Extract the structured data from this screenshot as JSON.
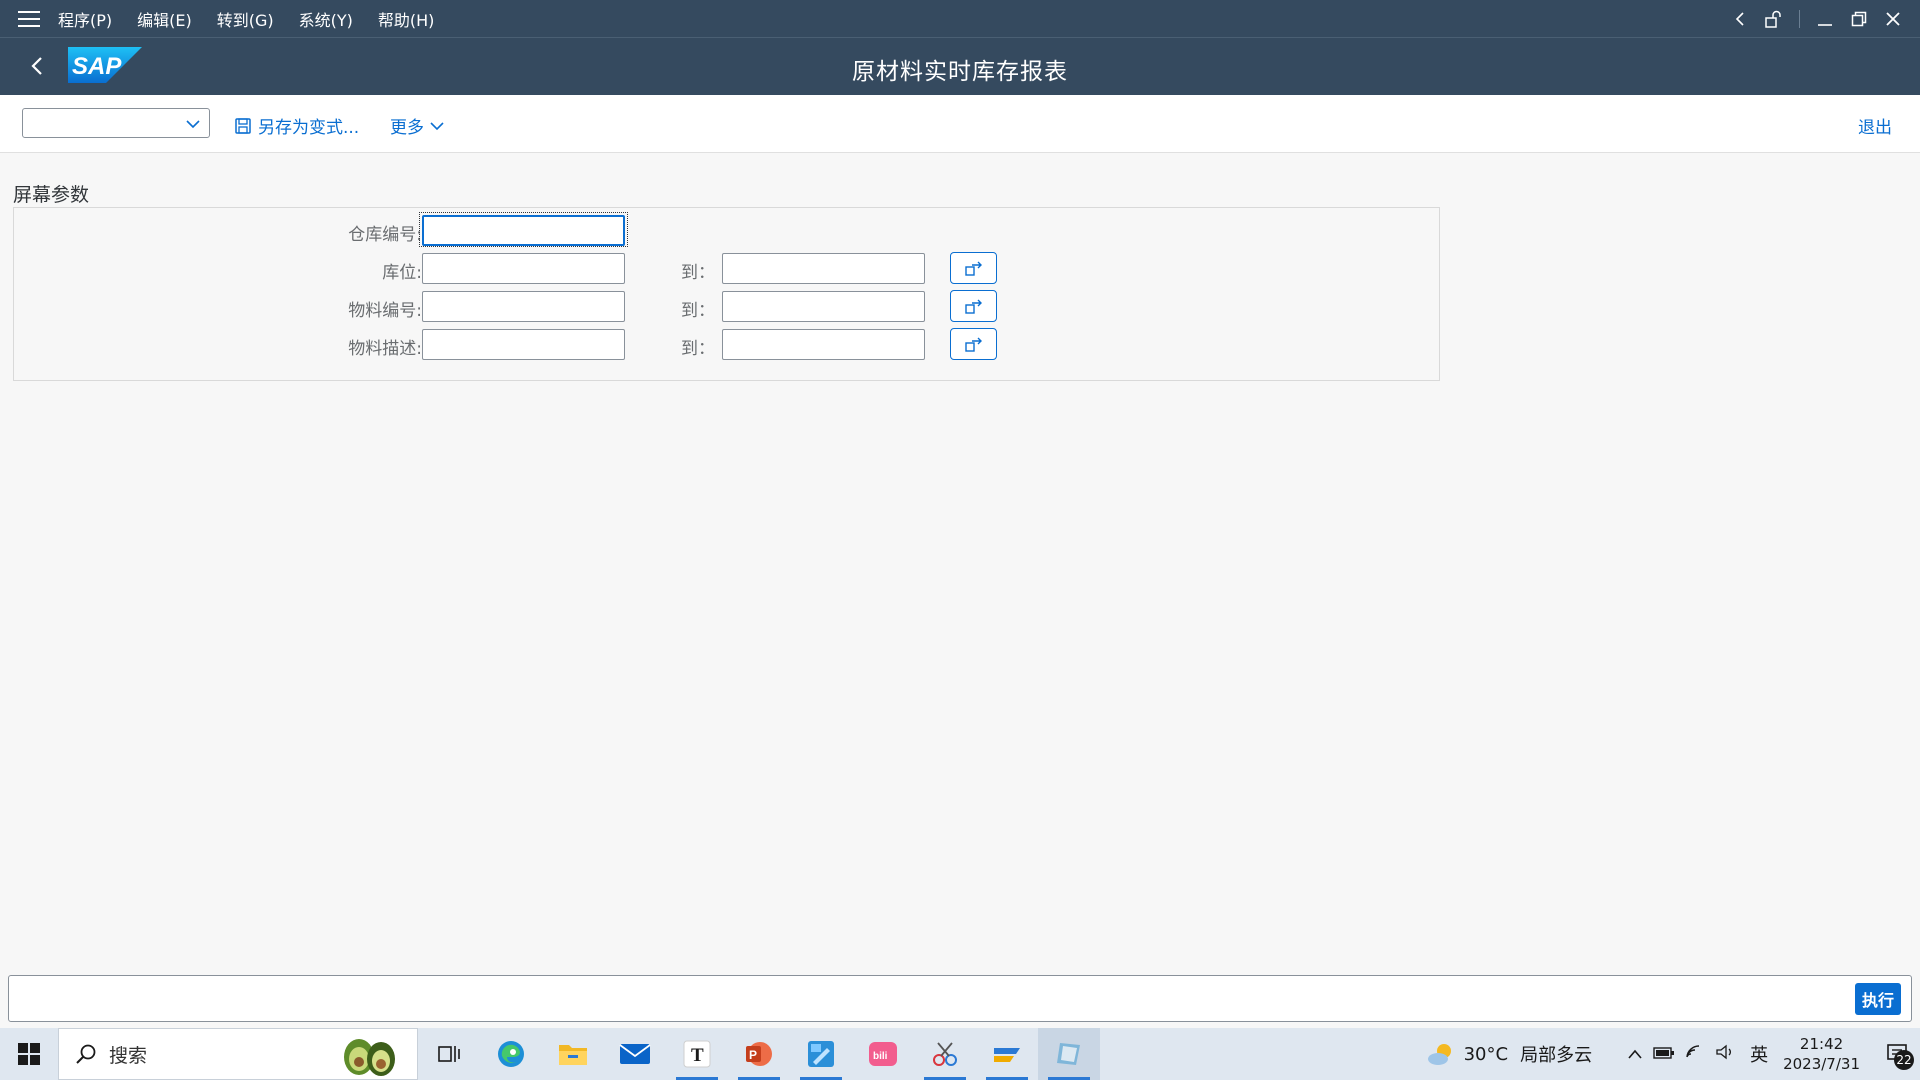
{
  "menu": {
    "items": [
      "程序(P)",
      "编辑(E)",
      "转到(G)",
      "系统(Y)",
      "帮助(H)"
    ]
  },
  "header": {
    "title": "原材料实时库存报表",
    "logo_text": "SAP"
  },
  "toolbar": {
    "variant_value": "",
    "save_variant_label": "另存为变式...",
    "more_label": "更多",
    "exit_label": "退出"
  },
  "form": {
    "section_title": "屏幕参数",
    "to_label": "到：",
    "fields": [
      {
        "label": "仓库编号:",
        "value": "",
        "has_range": false
      },
      {
        "label": "库位:",
        "value": "",
        "to_value": "",
        "has_range": true
      },
      {
        "label": "物料编号:",
        "value": "",
        "to_value": "",
        "has_range": true
      },
      {
        "label": "物料描述:",
        "value": "",
        "to_value": "",
        "has_range": true
      }
    ]
  },
  "command": {
    "value": "",
    "execute_label": "执行"
  },
  "taskbar": {
    "search_label": "搜索",
    "weather_temp": "30°C",
    "weather_desc": "局部多云",
    "ime": "英",
    "time": "21:42",
    "date": "2023/7/31",
    "notification_count": "22",
    "apps": [
      "task-view",
      "edge",
      "file-explorer",
      "mail",
      "typora",
      "powerpoint",
      "drawing-app",
      "bilibili",
      "snipping-tool",
      "sap-logon",
      "sap-gui"
    ]
  },
  "colors": {
    "shell": "#354a5f",
    "accent": "#0a6ed1",
    "background": "#f7f7f7"
  }
}
